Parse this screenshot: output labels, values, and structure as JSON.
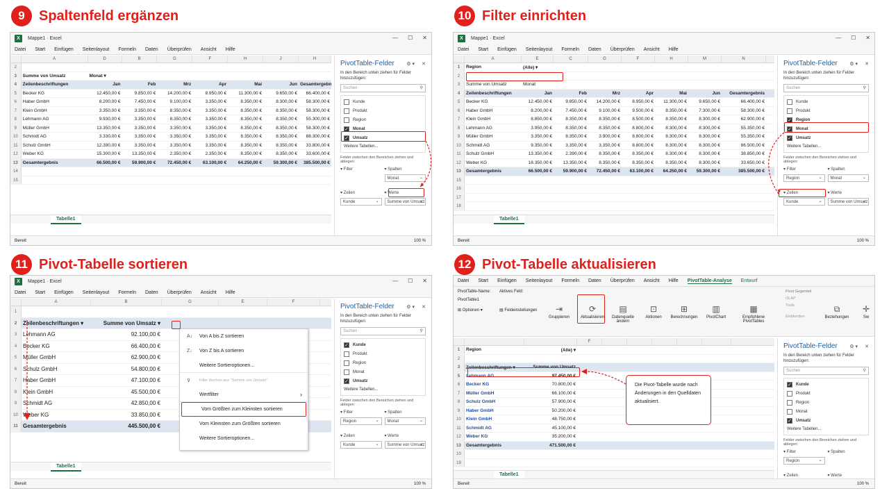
{
  "q1": {
    "num": "9",
    "title": "Spaltenfeld ergänzen",
    "win_title": "Mappe1 · Excel",
    "menu": [
      "Datei",
      "Start",
      "Einfügen",
      "Seitenlayout",
      "Formeln",
      "Daten",
      "Überprüfen",
      "Ansicht",
      "Hilfe"
    ],
    "cols": [
      "A",
      "B",
      "C",
      "D",
      "E",
      "F",
      "G",
      "H",
      "I"
    ],
    "rownums": [
      "2",
      "3",
      "4",
      "5",
      "6",
      "7",
      "8",
      "9",
      "10",
      "11",
      "12",
      "13",
      "14",
      "15"
    ],
    "r3": [
      "Summe von Umsatz",
      "Monat"
    ],
    "r4": [
      "Zeilenbeschriftungen",
      "Jan",
      "Feb",
      "Mrz",
      "Apr",
      "Mai",
      "Jun",
      "Gesamtergebnis"
    ],
    "rows": [
      [
        "Becker KG",
        "12.450,00 €",
        "9.850,00 €",
        "14.200,00 €",
        "8.950,00 €",
        "11.300,00 €",
        "9.650,00 €",
        "66.400,00 €"
      ],
      [
        "Haber GmbH",
        "8.200,00 €",
        "7.450,00 €",
        "9.100,00 €",
        "3.350,00 €",
        "8.350,00 €",
        "8.300,00 €",
        "58.300,00 €"
      ],
      [
        "Klein GmbH",
        "3.350,00 €",
        "3.350,00 €",
        "8.350,00 €",
        "3.350,00 €",
        "8.350,00 €",
        "8.350,00 €",
        "58.300,00 €"
      ],
      [
        "Lehmann AG",
        "9.930,00 €",
        "3.350,00 €",
        "8.350,00 €",
        "3.350,00 €",
        "8.350,00 €",
        "8.350,00 €",
        "55.300,00 €"
      ],
      [
        "Müller GmbH",
        "13.350,00 €",
        "3.350,00 €",
        "3.350,00 €",
        "3.350,00 €",
        "8.350,00 €",
        "8.350,00 €",
        "58.300,00 €"
      ],
      [
        "Schmidt AG",
        "3.330,00 €",
        "3.350,00 €",
        "3.350,00 €",
        "3.350,00 €",
        "8.350,00 €",
        "8.350,00 €",
        "88.300,00 €"
      ],
      [
        "Schulz GmbH",
        "12.390,00 €",
        "3.350,00 €",
        "3.350,00 €",
        "3.350,00 €",
        "8.350,00 €",
        "8.350,00 €",
        "33.800,00 €"
      ],
      [
        "Weber KG",
        "15.300,00 €",
        "13.350,00 €",
        "2.350,00 €",
        "2.350,00 €",
        "8.350,00 €",
        "8.350,00 €",
        "33.600,00 €"
      ]
    ],
    "total": [
      "Gesamtergebnis",
      "66.500,00 €",
      "59.900,00 €",
      "72.450,00 €",
      "63.100,00 €",
      "64.250,00 €",
      "59.300,00 €",
      "385.500,00 €"
    ],
    "pane": {
      "title": "PivotTable-Felder",
      "desc": "In den Bereich unten ziehen für Felder hinzuzufügen:",
      "search": "Suchen",
      "fields": [
        "Kunde",
        "Produkt",
        "Region",
        "Monat",
        "Umsatz"
      ],
      "checked": [
        false,
        false,
        false,
        true,
        true
      ],
      "more": "Weitere Tabellen...",
      "drag": "Felder zwischen den Bereichen ziehen und ablegen:",
      "filter": "Filter",
      "spalten": "Spalten",
      "zeilen": "Zeilen",
      "werte": "Werte",
      "spalten_val": "Monat",
      "zeilen_val": "Kunde",
      "werte_val": "Summe von Umsatz"
    },
    "sheet_tab": "Tabelle1",
    "status": "Bereit",
    "zoom": "100 %"
  },
  "q2": {
    "num": "10",
    "title": "Filter einrichten",
    "win_title": "Mappe1 · Excel",
    "menu": [
      "Datei",
      "Start",
      "Einfügen",
      "Seitenlayout",
      "Formeln",
      "Daten",
      "Überprüfen",
      "Ansicht",
      "Hilfe"
    ],
    "cols": [
      "A",
      "E",
      "C",
      "G",
      "F",
      "H",
      "M",
      "N"
    ],
    "rownums": [
      "1",
      "2",
      "3",
      "4",
      "5",
      "6",
      "7",
      "8",
      "9",
      "10",
      "11",
      "12",
      "13",
      "15",
      "16",
      "17",
      "18"
    ],
    "r1": [
      "Region",
      "(Alle)"
    ],
    "r3": [
      "Summe von Umsatz",
      "Monat"
    ],
    "r4": [
      "Zeilenbeschriftungen",
      "Jan",
      "Feb",
      "Mrz",
      "Apr",
      "Mai",
      "Jun",
      "Gesamtergebnis"
    ],
    "rows": [
      [
        "Becker KG",
        "12.450,00 €",
        "9.850,00 €",
        "14.200,00 €",
        "8.950,00 €",
        "11.300,00 €",
        "9.650,00 €",
        "66.400,00 €"
      ],
      [
        "Haber GmbH",
        "8.200,00 €",
        "7.450,00 €",
        "9.100,00 €",
        "9.500,00 €",
        "8.350,00 €",
        "7.300,00 €",
        "58.300,00 €"
      ],
      [
        "Klein GmbH",
        "8.850,00 €",
        "8.350,00 €",
        "8.350,00 €",
        "8.500,00 €",
        "8.350,00 €",
        "8.300,00 €",
        "62.900,00 €"
      ],
      [
        "Lehmann AG",
        "3.950,00 €",
        "8.350,00 €",
        "8.350,00 €",
        "8.800,00 €",
        "8.300,00 €",
        "8.300,00 €",
        "55.350,00 €"
      ],
      [
        "Müller GmbH",
        "3.350,00 €",
        "8.350,00 €",
        "3.900,00 €",
        "8.800,00 €",
        "8.300,00 €",
        "8.300,00 €",
        "55.350,00 €"
      ],
      [
        "Schmidt AG",
        "9.350,00 €",
        "3.350,00 €",
        "3.350,00 €",
        "8.800,00 €",
        "8.300,00 €",
        "8.300,00 €",
        "86.500,00 €"
      ],
      [
        "Schulz GmbH",
        "13.350,00 €",
        "2.390,00 €",
        "8.350,00 €",
        "8.350,00 €",
        "8.300,00 €",
        "8.300,00 €",
        "38.850,00 €"
      ],
      [
        "Weber KG",
        "18.350,00 €",
        "13.350,00 €",
        "8.350,00 €",
        "8.350,00 €",
        "8.350,00 €",
        "8.300,00 €",
        "33.650,00 €"
      ]
    ],
    "total": [
      "Gesamtergebnis",
      "66.500,00 €",
      "59.900,00 €",
      "72.450,00 €",
      "63.100,00 €",
      "64.250,00 €",
      "59.300,00 €",
      "385.500,00 €"
    ],
    "pane": {
      "title": "PivotTable-Felder",
      "desc": "In den Bereich unten ziehen für Felder hinzuzufügen:",
      "search": "Suchen",
      "fields": [
        "Kunde",
        "Produkt",
        "Region",
        "Monat",
        "Umsatz"
      ],
      "checked": [
        false,
        false,
        true,
        true,
        true
      ],
      "more": "Weitere Tabellen...",
      "drag": "Felder zwischen den Bereichen ziehen und ablegen:",
      "filter": "Filter",
      "spalten": "Spalten",
      "zeilen": "Zeilen",
      "werte": "Werte",
      "filter_val": "Region",
      "spalten_val": "Monat",
      "zeilen_val": "Kunde",
      "werte_val": "Summe von Umsatz"
    },
    "sheet_tab": "Tabelle1",
    "status": "Bereit",
    "zoom": "100 %"
  },
  "q3": {
    "num": "11",
    "title": "Pivot-Tabelle sortieren",
    "win_title": "Mappe1 · Excel",
    "menu": [
      "Datei",
      "Start",
      "Einfügen",
      "Seitenlayout",
      "Formeln",
      "Daten",
      "Überprüfen",
      "Ansicht",
      "Hilfe"
    ],
    "cols": [
      "A",
      "B",
      "G",
      "E",
      "F"
    ],
    "rownums": [
      "1",
      "2",
      "3",
      "4",
      "5",
      "6",
      "7",
      "8",
      "9",
      "10",
      "11"
    ],
    "r2": [
      "Zeilenbeschriftungen",
      "Summe von Umsatz"
    ],
    "rows": [
      [
        "Lehmann AG",
        "92.100,00 €"
      ],
      [
        "Becker KG",
        "66.400,00 €"
      ],
      [
        "Müller GmbH",
        "62.900,00 €"
      ],
      [
        "Schulz GmbH",
        "54.800,00 €"
      ],
      [
        "Haber GmbH",
        "47.100,00 €"
      ],
      [
        "Klein GmbH",
        "45.500,00 €"
      ],
      [
        "Schmidt AG",
        "42.850,00 €"
      ],
      [
        "Weber KG",
        "33.850,00 €"
      ]
    ],
    "total": [
      "Gesamtergebnis",
      "445.500,00 €"
    ],
    "dropdown": [
      "Von A bis Z sortieren",
      "Von Z bis A sortieren",
      "Weitere Sortieroptionen...",
      "Filter löschen aus \"Summe von Umsatz\"",
      "Wertfilter",
      "Vom Größten zum Kleinsten sortieren",
      "Vom Kleinsten zum Größten sortieren",
      "Weitere Sortieroptionen..."
    ],
    "pane": {
      "title": "PivotTable-Felder",
      "desc": "In den Bereich unten ziehen für Felder hinzuzufügen:",
      "search": "Suchen",
      "fields": [
        "Kunde",
        "Produkt",
        "Region",
        "Monat",
        "Umsatz"
      ],
      "checked": [
        true,
        false,
        false,
        false,
        true
      ],
      "more": "Weitere Tabellen...",
      "drag": "Felder zwischen den Bereichen ziehen und ablegen:",
      "filter": "Filter",
      "spalten": "Spalten",
      "zeilen": "Zeilen",
      "werte": "Werte",
      "filter_val": "Region",
      "spalten_val": "Monat",
      "zeilen_val": "Kunde",
      "werte_val": "Summe von Umsatz"
    },
    "sheet_tab": "Tabelle1",
    "status": "Bereit",
    "zoom": "100 %"
  },
  "q4": {
    "num": "12",
    "title": "Pivot-Tabelle aktualisieren",
    "menu": [
      "Datei",
      "Start",
      "Einfügen",
      "Seitenlayout",
      "Formeln",
      "Daten",
      "Überprüfen",
      "Ansicht",
      "Hilfe",
      "PivotTable-Analyse",
      "Entwurf"
    ],
    "ribbon": {
      "pt_name_lbl": "PivotTable-Name:",
      "pt_name": "PivotTable1",
      "aktives": "Aktives Feld:",
      "optionen": "Optionen",
      "feldeinst": "Feldeinstellungen",
      "gruppieren": "Gruppieren",
      "aktualisieren": "Aktualisieren",
      "datenquelle": "Datenquelle ändern",
      "aktionen": "Aktionen",
      "berechnungen": "Berechnungen",
      "pivotchart": "PivotChart",
      "empfohlene": "Empfohlene PivotTables",
      "pivot_ggf": "Pivot Gegenteil",
      "olap": "OLAP",
      "tools": "Tools",
      "beziehungen": "Beziehungen",
      "zeig": "Zeigen",
      "einblenden": "Einblenden",
      "sw": "Sw"
    },
    "rownums": [
      "1",
      "2",
      "3",
      "5",
      "6",
      "7",
      "8",
      "9",
      "10",
      "11",
      "12",
      "13",
      "10",
      "19"
    ],
    "r1": [
      "Region",
      "(Alle)"
    ],
    "r3": [
      "Zeilenbeschriftungen",
      "Summe von Umsatz"
    ],
    "rows": [
      [
        "Lehmann AG",
        "97.450,00 €"
      ],
      [
        "Becker KG",
        "70.800,00 €"
      ],
      [
        "Müller GmbH",
        "66.100,00 €"
      ],
      [
        "Schulz GmbH",
        "57.900,00 €"
      ],
      [
        "Haber GmbH",
        "50.200,00 €"
      ],
      [
        "Klein GmbH",
        "48.750,00 €"
      ],
      [
        "Schmidt AG",
        "45.100,00 €"
      ],
      [
        "Weber KG",
        "35.200,00 €"
      ]
    ],
    "total": [
      "Gesamtergebnis",
      "471.500,00 €"
    ],
    "callout": "Die Pivot-Tabelle wurde nach Änderungen in den Quelldaten aktualisiert.",
    "pane": {
      "title": "PivotTable-Felder",
      "desc": "In den Bereich unten ziehen für Felder hinzuzufügen:",
      "search": "Suchen",
      "fields": [
        "Kunde",
        "Produkt",
        "Region",
        "Monat",
        "Umsatz"
      ],
      "checked": [
        true,
        false,
        false,
        false,
        true
      ],
      "more": "Weitere Tabellen...",
      "drag": "Felder zwischen den Bereichen ziehen und ablegen:",
      "filter": "Filter",
      "spalten": "Spalten",
      "zeilen": "Zeilen",
      "werte": "Werte",
      "filter_val": "Region",
      "zeilen_val": "Kunde",
      "werte_val": "Summe von Umsatz"
    },
    "sheet_tab": "Tabelle1",
    "status": "Bereit",
    "zoom": "100 %"
  },
  "colors": {
    "accent": "#e0201a",
    "excel": "#1d6f42",
    "pivot_header": "#dde5f0"
  }
}
